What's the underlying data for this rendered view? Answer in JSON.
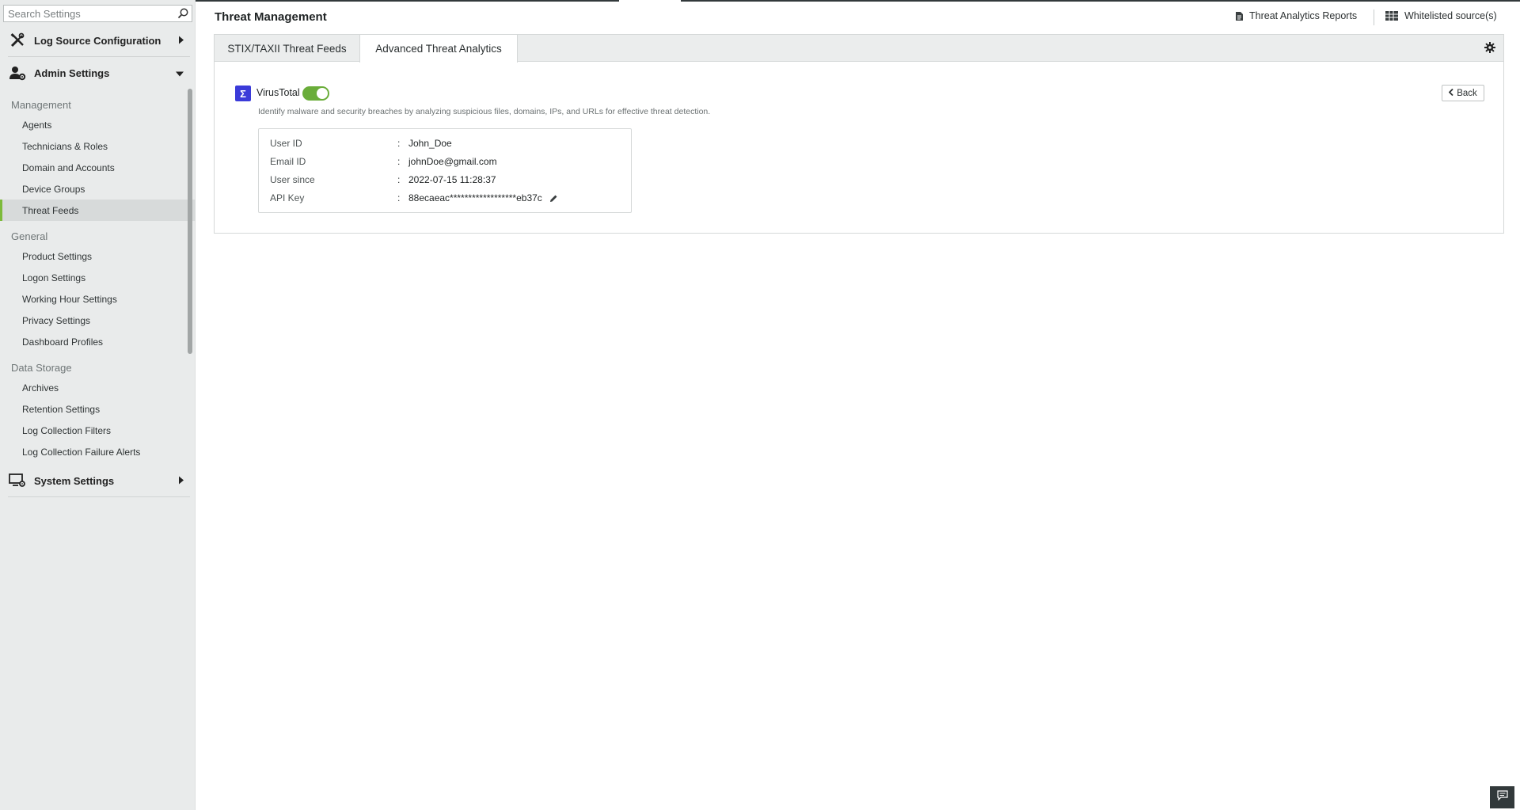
{
  "sidebar": {
    "search_placeholder": "Search Settings",
    "sections": {
      "log_source": "Log Source Configuration",
      "admin": "Admin Settings",
      "system": "System Settings"
    },
    "groups": {
      "management": "Management",
      "general": "General",
      "data_storage": "Data Storage"
    },
    "management_items": [
      "Agents",
      "Technicians & Roles",
      "Domain and Accounts",
      "Device Groups",
      "Threat Feeds"
    ],
    "general_items": [
      "Product Settings",
      "Logon Settings",
      "Working Hour Settings",
      "Privacy Settings",
      "Dashboard Profiles"
    ],
    "data_storage_items": [
      "Archives",
      "Retention Settings",
      "Log Collection Filters",
      "Log Collection Failure Alerts"
    ],
    "active_item": "Threat Feeds"
  },
  "header": {
    "title": "Threat Management",
    "reports_link": "Threat Analytics Reports",
    "whitelist_link": "Whitelisted source(s)"
  },
  "tabs": [
    "STIX/TAXII Threat Feeds",
    "Advanced Threat Analytics"
  ],
  "active_tab": "Advanced Threat Analytics",
  "integration": {
    "logo_glyph": "Σ",
    "name": "VirusTotal",
    "enabled": true,
    "description": "Identify malware and security breaches by analyzing suspicious files, domains, IPs, and URLs for effective threat detection.",
    "back_label": "Back"
  },
  "details": {
    "separator": ":",
    "rows": [
      {
        "label": "User ID",
        "value": "John_Doe"
      },
      {
        "label": "Email ID",
        "value": "johnDoe@gmail.com"
      },
      {
        "label": "User since",
        "value": "2022-07-15 11:28:37"
      },
      {
        "label": "API Key",
        "value": "88ecaeac******************eb37c"
      }
    ]
  },
  "colors": {
    "accent_green": "#6aad3a",
    "virustotal_blue": "#3b3bd9",
    "topbar_dark": "#32393b"
  }
}
